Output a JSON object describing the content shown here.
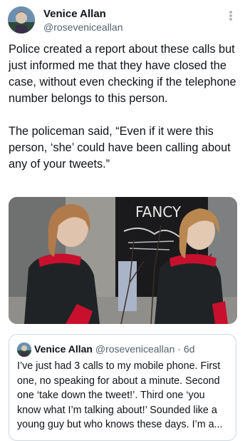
{
  "author": {
    "name": "Venice Allan",
    "handle": "@rosevenicеallan"
  },
  "post": {
    "text": "Police created a report about these calls but just informed me that they have closed the case, without even checking if the telephone number belongs to this person.\n\nThe policeman said, “Even if it were this person, ‘she’ could have been calling about any of your tweets.”",
    "photo_graffiti": "FANCY"
  },
  "quote": {
    "name": "Venice Allan",
    "handle": "@rosevenicеallan",
    "separator": "·",
    "time": "6d",
    "text": "I’ve just had 3 calls to my mobile phone. First one, no speaking for about a minute. Second one ‘take down the tweet!’. Third one ‘you know what I’m talking about!’ Sounded like a young guy but who knows these days. I’m a..."
  },
  "colors": {
    "text": "#0f1419",
    "secondary": "#536471",
    "border": "#cfd9de",
    "jacket": "#1f2326",
    "scarf": "#c8102e"
  },
  "icons": {
    "more": "more-vertical-icon"
  }
}
